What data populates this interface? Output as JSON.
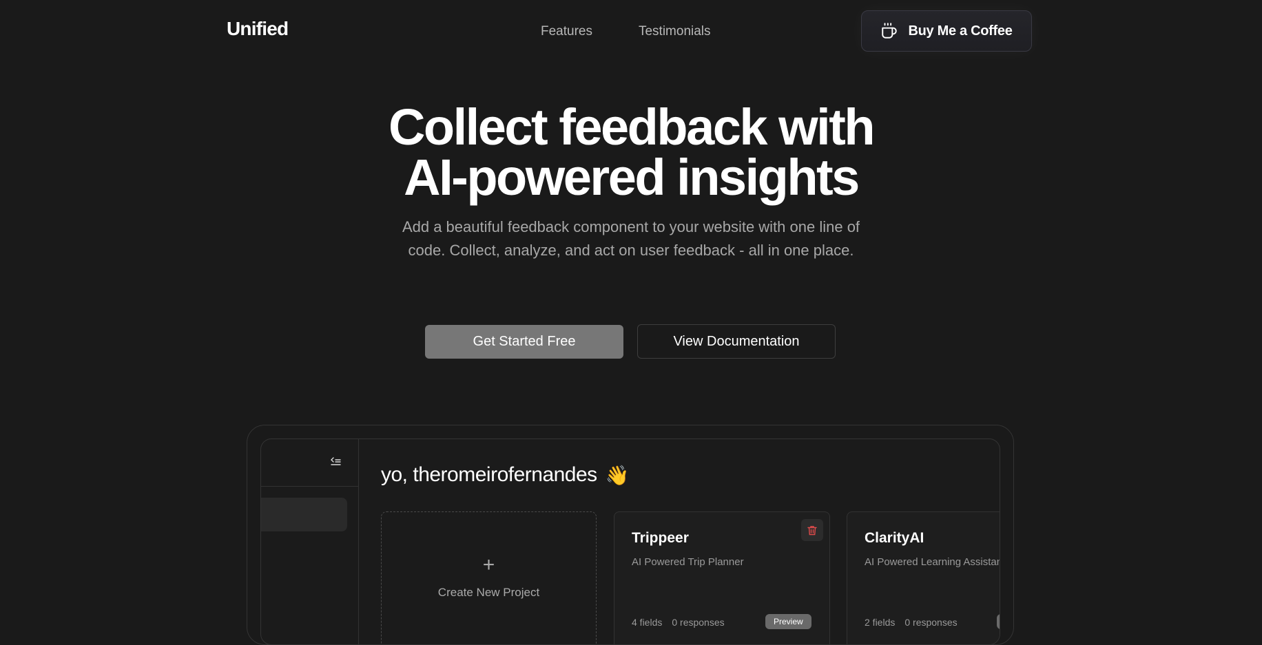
{
  "nav": {
    "logo": "Unified",
    "links": [
      "Features",
      "Testimonials"
    ],
    "coffee_label": "Buy Me a Coffee",
    "coffee_icon": "coffee-cup-icon"
  },
  "hero": {
    "title_line1": "Collect feedback with",
    "title_line2": "AI-powered insights",
    "subtitle": "Add a beautiful feedback component to your website with one line of code. Collect, analyze, and act on user feedback - all in one place.",
    "primary_cta": "Get Started Free",
    "secondary_cta": "View Documentation"
  },
  "dashboard": {
    "greeting": "yo, theromeirofernandes",
    "greeting_emoji": "👋",
    "collapse_icon": "collapse-sidebar-icon",
    "create_plus": "+",
    "create_label": "Create New Project",
    "projects": [
      {
        "name": "Trippeer",
        "description": "AI Powered Trip Planner",
        "fields": "4 fields",
        "responses": "0 responses",
        "badge": "Preview"
      },
      {
        "name": "ClarityAI",
        "description": "AI Powered Learning Assistant",
        "fields": "2 fields",
        "responses": "0 responses",
        "badge": "Preview"
      }
    ]
  },
  "colors": {
    "background": "#1a1a1a",
    "primary_button": "#777777",
    "delete_icon": "#e04b4b",
    "muted_text": "#a8a8a8"
  }
}
